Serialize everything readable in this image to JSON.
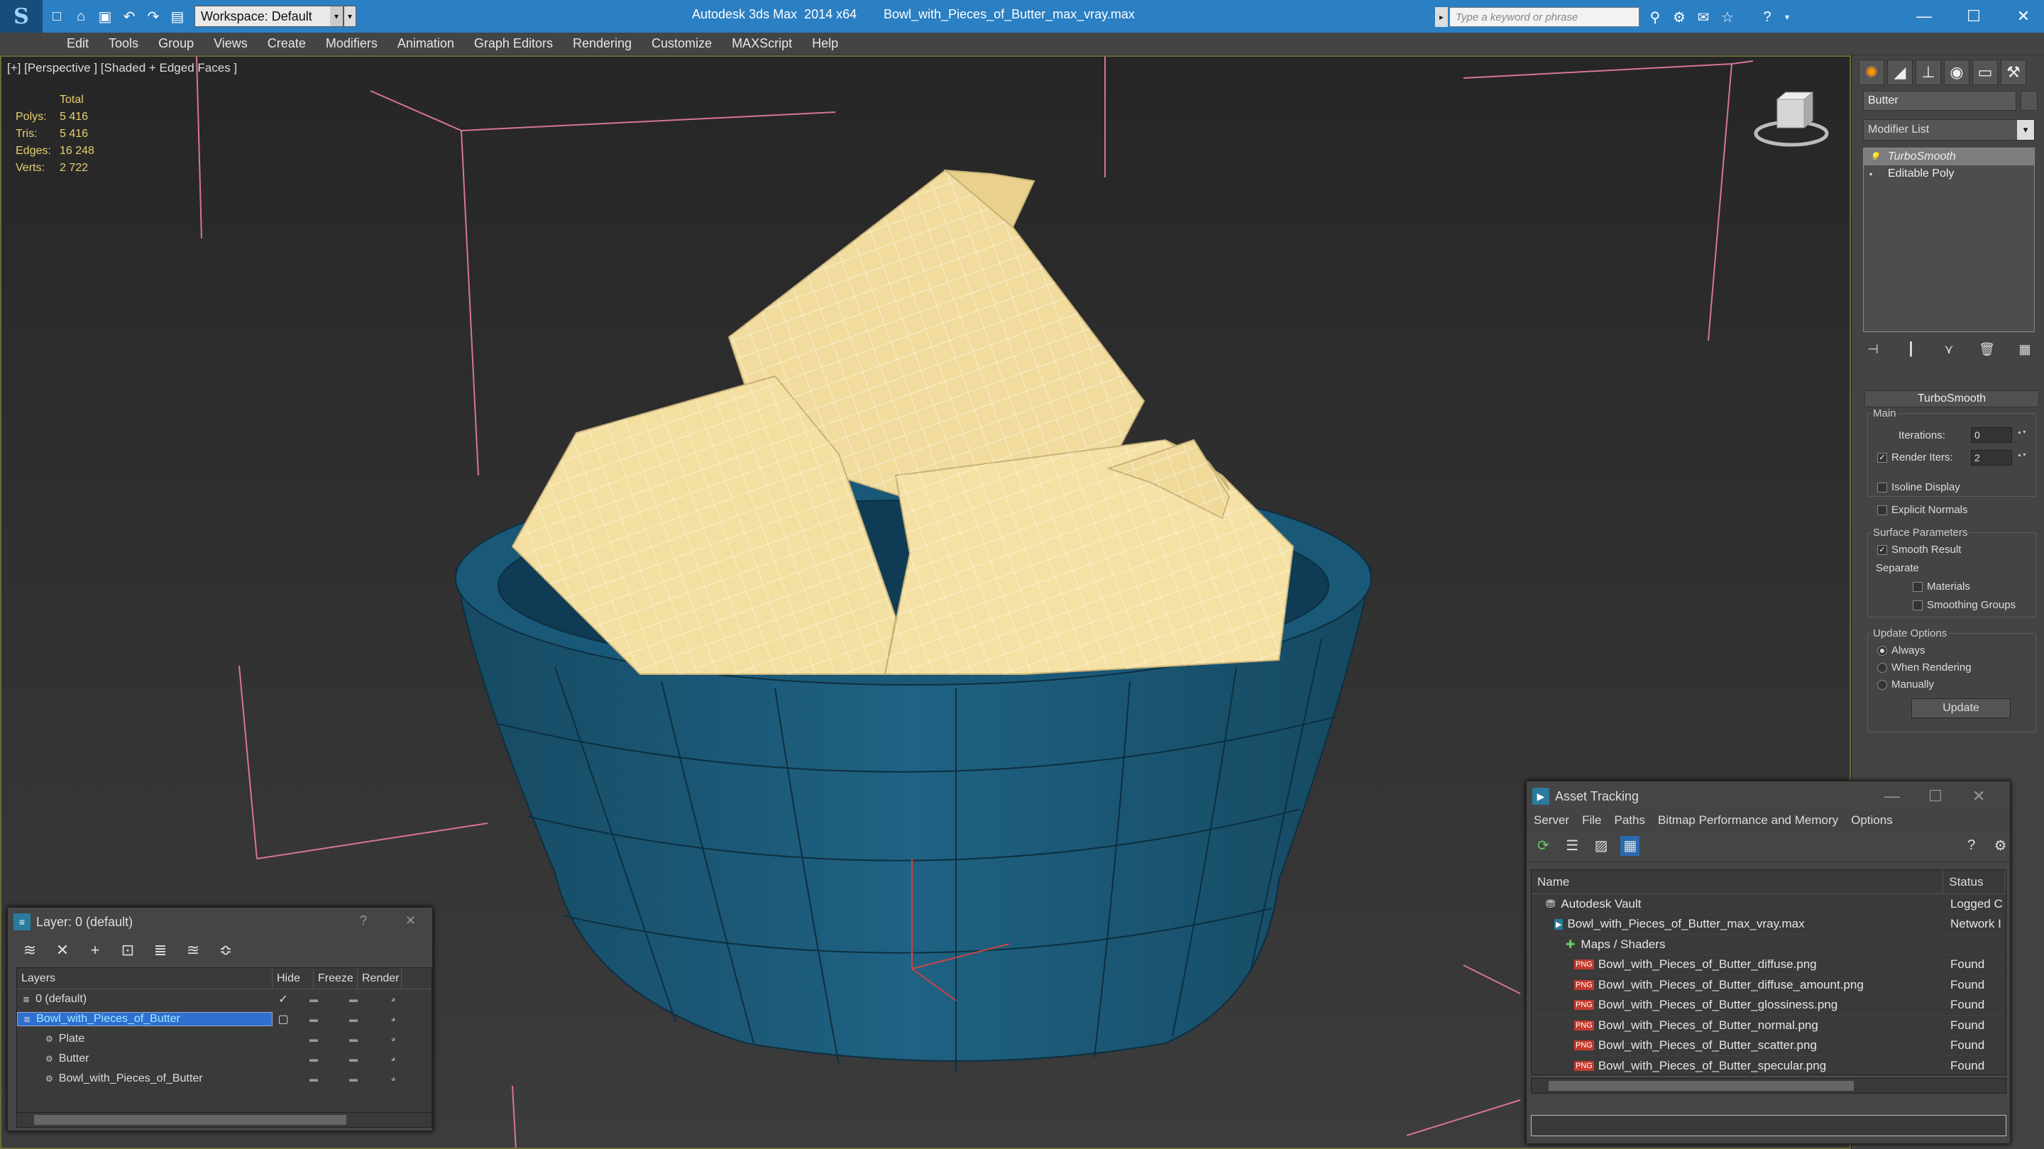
{
  "titlebar": {
    "app_title": "Autodesk 3ds Max  2014 x64",
    "file_title": "Bowl_with_Pieces_of_Butter_max_vray.max",
    "workspace_label": "Workspace: Default",
    "search_placeholder": "Type a keyword or phrase",
    "help_icon": "?"
  },
  "menu": [
    "Edit",
    "Tools",
    "Group",
    "Views",
    "Create",
    "Modifiers",
    "Animation",
    "Graph Editors",
    "Rendering",
    "Customize",
    "MAXScript",
    "Help"
  ],
  "viewport": {
    "label": "[+] [Perspective ] [Shaded + Edged Faces ]",
    "stats_header": "Total",
    "stats": [
      {
        "key": "Polys:",
        "value": "5 416"
      },
      {
        "key": "Tris:",
        "value": "5 416"
      },
      {
        "key": "Edges:",
        "value": "16 248"
      },
      {
        "key": "Verts:",
        "value": "2 722"
      }
    ],
    "bowl_color": "#1f5f7f",
    "butter_color": "#f3dfa0"
  },
  "command_panel": {
    "object_name": "Butter",
    "modifier_list": "Modifier List",
    "stack": [
      {
        "label": "TurboSmooth",
        "selected": true
      },
      {
        "label": "Editable Poly",
        "selected": false
      }
    ],
    "turbosmooth": {
      "title": "TurboSmooth",
      "main_group": "Main",
      "iterations_label": "Iterations:",
      "iterations_value": "0",
      "render_iters_label": "Render Iters:",
      "render_iters_value": "2",
      "isoline": "Isoline Display",
      "explicit_normals": "Explicit Normals",
      "surface_group": "Surface Parameters",
      "smooth_result": "Smooth Result",
      "separate": "Separate",
      "materials": "Materials",
      "smoothing_groups": "Smoothing Groups",
      "update_group": "Update Options",
      "always": "Always",
      "when_rendering": "When Rendering",
      "manually": "Manually",
      "update_button": "Update"
    }
  },
  "layer_window": {
    "title": "Layer: 0 (default)",
    "columns": [
      "Layers",
      "Hide",
      "Freeze",
      "Render"
    ],
    "rows": [
      {
        "name": "0 (default)",
        "selected": false,
        "indent": 0
      },
      {
        "name": "Bowl_with_Pieces_of_Butter",
        "selected": true,
        "indent": 0
      },
      {
        "name": "Plate",
        "selected": false,
        "indent": 1
      },
      {
        "name": "Butter",
        "selected": false,
        "indent": 1
      },
      {
        "name": "Bowl_with_Pieces_of_Butter",
        "selected": false,
        "indent": 1
      }
    ]
  },
  "asset_window": {
    "title": "Asset Tracking",
    "menu": [
      "Server",
      "File",
      "Paths",
      "Bitmap Performance and Memory",
      "Options"
    ],
    "columns": [
      "Name",
      "Status"
    ],
    "rows": [
      {
        "name": "Autodesk Vault",
        "status": "Logged C",
        "icon": "vault",
        "indent": 1
      },
      {
        "name": "Bowl_with_Pieces_of_Butter_max_vray.max",
        "status": "Network I",
        "icon": "max",
        "indent": 2
      },
      {
        "name": "Maps / Shaders",
        "status": "",
        "icon": "map",
        "indent": 3
      },
      {
        "name": "Bowl_with_Pieces_of_Butter_diffuse.png",
        "status": "Found",
        "icon": "png",
        "indent": 4
      },
      {
        "name": "Bowl_with_Pieces_of_Butter_diffuse_amount.png",
        "status": "Found",
        "icon": "png",
        "indent": 4
      },
      {
        "name": "Bowl_with_Pieces_of_Butter_glossiness.png",
        "status": "Found",
        "icon": "png",
        "indent": 4
      },
      {
        "name": "Bowl_with_Pieces_of_Butter_normal.png",
        "status": "Found",
        "icon": "png",
        "indent": 4
      },
      {
        "name": "Bowl_with_Pieces_of_Butter_scatter.png",
        "status": "Found",
        "icon": "png",
        "indent": 4
      },
      {
        "name": "Bowl_with_Pieces_of_Butter_specular.png",
        "status": "Found",
        "icon": "png",
        "indent": 4
      }
    ]
  }
}
